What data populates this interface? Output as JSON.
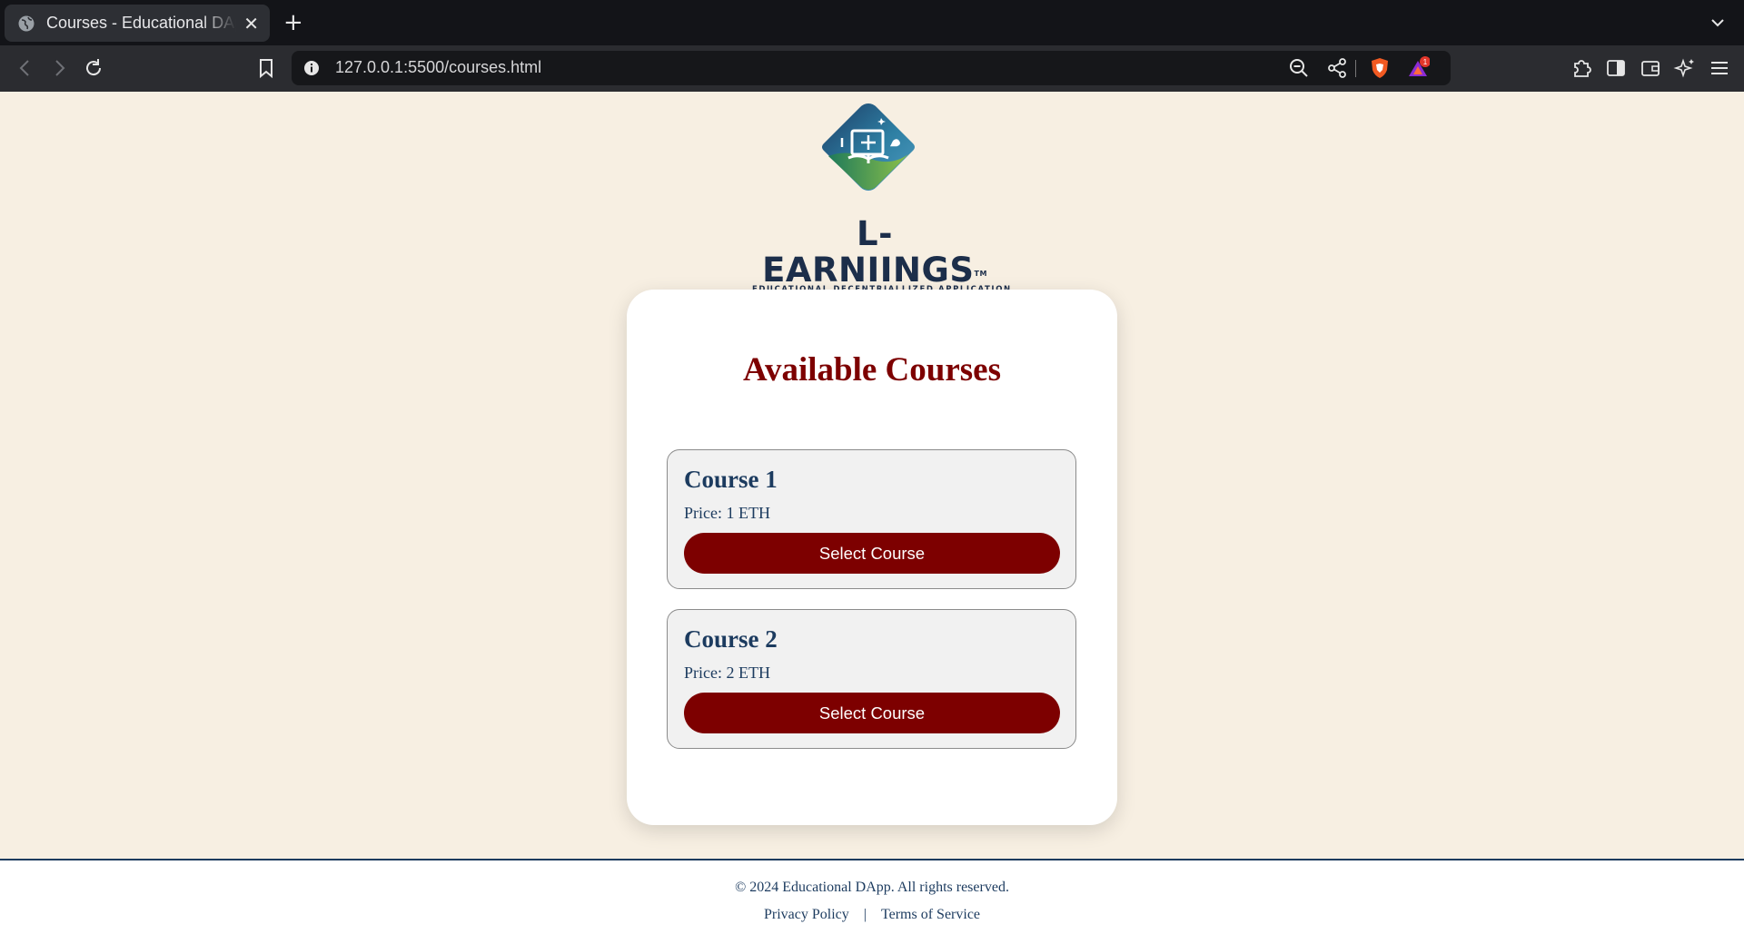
{
  "browser": {
    "tab_title": "Courses - Educational DApp",
    "url": "127.0.0.1:5500/courses.html",
    "notification_count": "1",
    "icons": {
      "tab": "globe-icon",
      "close": "close-icon",
      "new_tab": "plus-icon",
      "tab_list": "chevron-down-icon",
      "back": "back-arrow-icon",
      "forward": "forward-arrow-icon",
      "reload": "reload-icon",
      "bookmark": "bookmark-icon",
      "site_info": "info-icon",
      "zoom": "zoom-out-icon",
      "share": "share-icon",
      "shields": "brave-shields-icon",
      "rewards": "brave-rewards-icon",
      "extensions": "puzzle-icon",
      "sidebar": "sidebar-icon",
      "wallet": "wallet-icon",
      "leo": "ai-sparkle-icon",
      "menu": "hamburger-menu-icon"
    }
  },
  "brand": {
    "name": "L-EARNIINGS",
    "trademark": "TM",
    "tagline": "EDUCATIONAL DECENTRIALLIZED APPLICATION"
  },
  "main": {
    "title": "Available Courses",
    "courses": [
      {
        "name": "Course 1",
        "price": "Price: 1 ETH",
        "button": "Select Course"
      },
      {
        "name": "Course 2",
        "price": "Price: 2 ETH",
        "button": "Select Course"
      }
    ]
  },
  "footer": {
    "copyright": "© 2024 Educational DApp. All rights reserved.",
    "privacy": "Privacy Policy",
    "separator": "|",
    "terms": "Terms of Service"
  },
  "colors": {
    "page_bg": "#f7efe2",
    "accent": "#7d0000",
    "navy": "#1c3b5f"
  }
}
